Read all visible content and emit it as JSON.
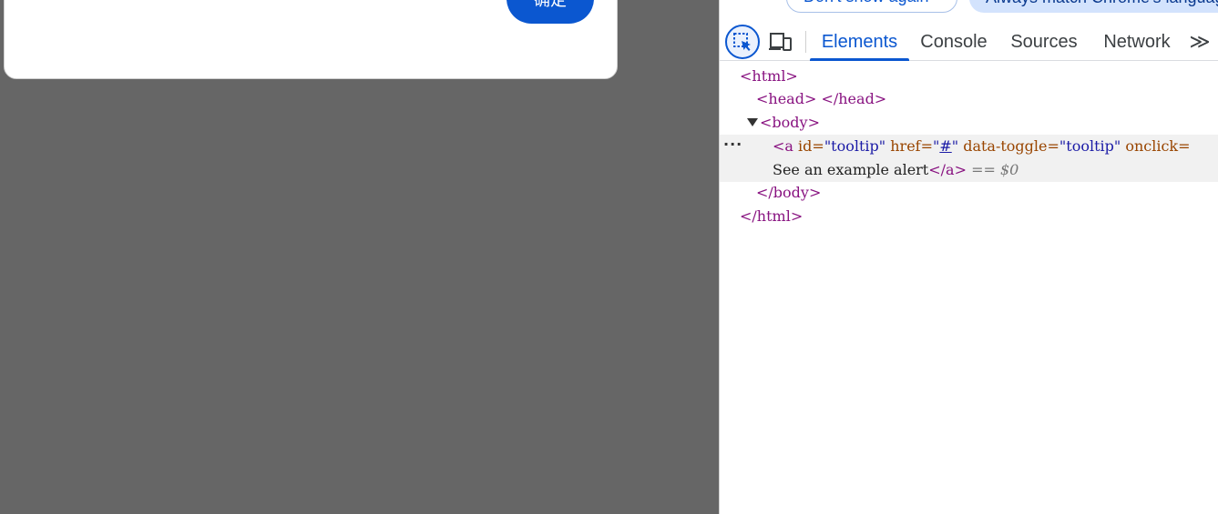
{
  "dialog": {
    "ok_label": "确定"
  },
  "devtools": {
    "infobar": {
      "dont_show": "Don't show again",
      "match_language": "Always match Chrome's language"
    },
    "tabs": [
      "Elements",
      "Console",
      "Sources",
      "Network"
    ],
    "more_tabs": "≫",
    "dom": {
      "html_open": "<html>",
      "head": "<head> </head>",
      "body_open": "<body>",
      "a_tag_open": "<a",
      "a_id_name": "id=",
      "a_id_value": "\"tooltip\"",
      "a_href_name": "href=",
      "a_href_q1": "\"",
      "a_href_value": "#",
      "a_href_q2": "\"",
      "a_toggle_name": "data-toggle=",
      "a_toggle_value": "\"tooltip\"",
      "a_onclick_name": "onclick=",
      "a_text": "See an example alert",
      "a_close": "</a>",
      "selected_marker": "== $0",
      "body_close": "</body>",
      "html_close": "</html>"
    },
    "colors": {
      "accent": "#0b57d0"
    }
  }
}
